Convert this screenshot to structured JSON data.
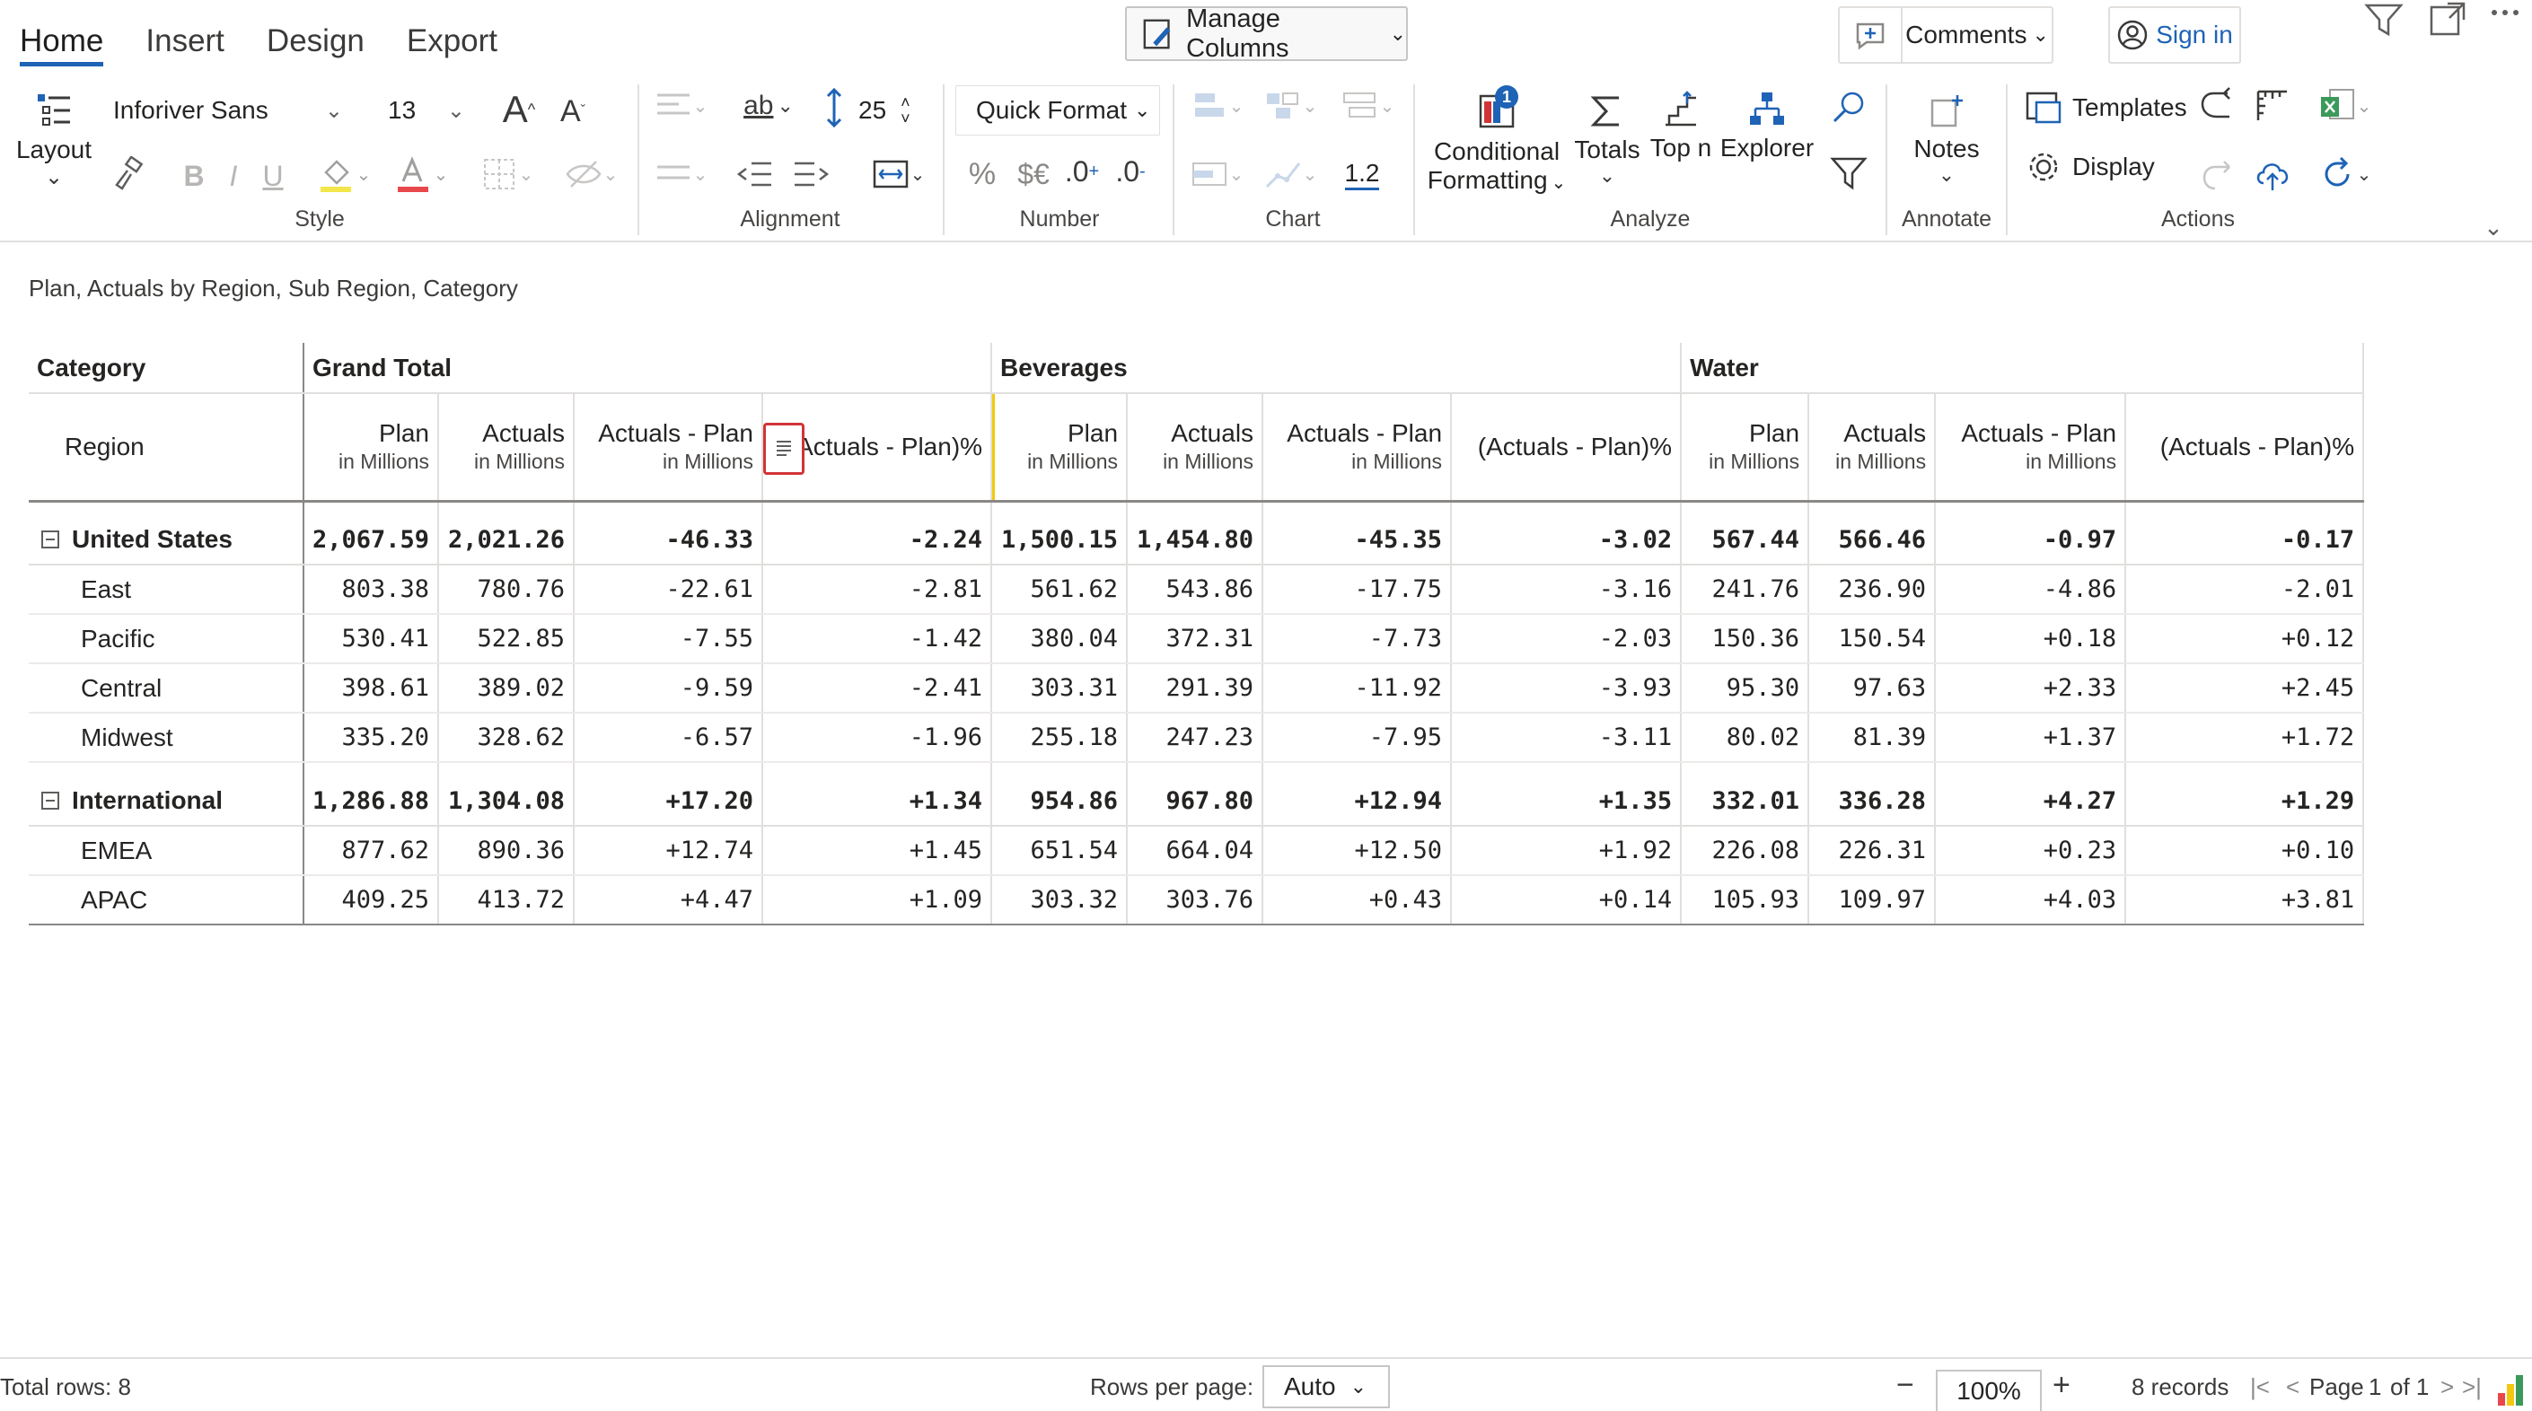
{
  "tabs": [
    "Home",
    "Insert",
    "Design",
    "Export"
  ],
  "header": {
    "manage_columns": "Manage Columns",
    "comments": "Comments",
    "sign_in": "Sign in"
  },
  "ribbon": {
    "layout_label": "Layout",
    "font_family": "Inforiver Sans",
    "font_size": "13",
    "line_height": "25",
    "quick_format": "Quick Format",
    "number_format": "1.2",
    "conditional_label1": "Conditional",
    "conditional_label2": "Formatting",
    "conditional_badge": "1",
    "totals_label": "Totals",
    "topn_label": "Top n",
    "explorer_label": "Explorer",
    "notes_label": "Notes",
    "templates_label": "Templates",
    "display_label": "Display",
    "groups": {
      "style": "Style",
      "alignment": "Alignment",
      "number": "Number",
      "chart": "Chart",
      "analyze": "Analyze",
      "annotate": "Annotate",
      "actions": "Actions"
    }
  },
  "report": {
    "title": "Plan, Actuals by Region, Sub Region, Category",
    "category_label": "Category",
    "region_label": "Region",
    "groups": [
      "Grand Total",
      "Beverages",
      "Water"
    ],
    "measures": [
      {
        "name": "Plan",
        "unit": "in Millions"
      },
      {
        "name": "Actuals",
        "unit": "in Millions"
      },
      {
        "name": "Actuals - Plan",
        "unit": "in Millions"
      },
      {
        "name": "(Actuals - Plan)%",
        "unit": ""
      }
    ],
    "rows": [
      {
        "label": "United States",
        "total": true,
        "values": [
          "2,067.59",
          "2,021.26",
          "-46.33",
          "-2.24",
          "1,500.15",
          "1,454.80",
          "-45.35",
          "-3.02",
          "567.44",
          "566.46",
          "-0.97",
          "-0.17"
        ]
      },
      {
        "label": "East",
        "values": [
          "803.38",
          "780.76",
          "-22.61",
          "-2.81",
          "561.62",
          "543.86",
          "-17.75",
          "-3.16",
          "241.76",
          "236.90",
          "-4.86",
          "-2.01"
        ]
      },
      {
        "label": "Pacific",
        "values": [
          "530.41",
          "522.85",
          "-7.55",
          "-1.42",
          "380.04",
          "372.31",
          "-7.73",
          "-2.03",
          "150.36",
          "150.54",
          "+0.18",
          "+0.12"
        ]
      },
      {
        "label": "Central",
        "values": [
          "398.61",
          "389.02",
          "-9.59",
          "-2.41",
          "303.31",
          "291.39",
          "-11.92",
          "-3.93",
          "95.30",
          "97.63",
          "+2.33",
          "+2.45"
        ]
      },
      {
        "label": "Midwest",
        "values": [
          "335.20",
          "328.62",
          "-6.57",
          "-1.96",
          "255.18",
          "247.23",
          "-7.95",
          "-3.11",
          "80.02",
          "81.39",
          "+1.37",
          "+1.72"
        ]
      },
      {
        "label": "International",
        "total": true,
        "values": [
          "1,286.88",
          "1,304.08",
          "+17.20",
          "+1.34",
          "954.86",
          "967.80",
          "+12.94",
          "+1.35",
          "332.01",
          "336.28",
          "+4.27",
          "+1.29"
        ]
      },
      {
        "label": "EMEA",
        "values": [
          "877.62",
          "890.36",
          "+12.74",
          "+1.45",
          "651.54",
          "664.04",
          "+12.50",
          "+1.92",
          "226.08",
          "226.31",
          "+0.23",
          "+0.10"
        ]
      },
      {
        "label": "APAC",
        "values": [
          "409.25",
          "413.72",
          "+4.47",
          "+1.09",
          "303.32",
          "303.76",
          "+0.43",
          "+0.14",
          "105.93",
          "109.97",
          "+4.03",
          "+3.81"
        ]
      }
    ]
  },
  "footer": {
    "total_rows": "Total rows: 8",
    "rows_per_page_label": "Rows per page:",
    "rows_per_page_value": "Auto",
    "zoom": "100%",
    "records": "8 records",
    "page_label": "Page",
    "page_current": "1",
    "page_of": "of 1"
  },
  "colors": {
    "accent": "#1e63b5",
    "highlight_border": "#d13438",
    "column_guide": "#f2c811"
  }
}
